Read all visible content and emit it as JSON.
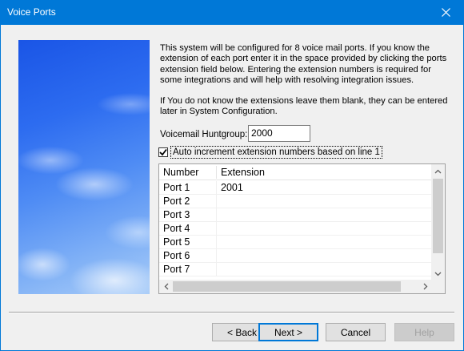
{
  "window": {
    "title": "Voice Ports",
    "close_icon": "close-icon"
  },
  "intro": {
    "paragraph1": "This system will be configured for 8 voice mail ports.  If you know the extension of each port enter it in the space provided by clicking the ports extension field below.  Entering the extension numbers is required for some integrations and will help with resolving integration issues.",
    "paragraph2": "If You do not know the extensions leave them blank, they can be entered later in System Configuration."
  },
  "huntgroup": {
    "label": "Voicemail Huntgroup:",
    "value": "2000"
  },
  "auto_increment": {
    "label": "Auto increment extension numbers based on line 1",
    "checked": true
  },
  "grid": {
    "columns": [
      "Number",
      "Extension"
    ],
    "rows": [
      {
        "number": "Port 1",
        "extension": "2001"
      },
      {
        "number": "Port 2",
        "extension": ""
      },
      {
        "number": "Port 3",
        "extension": ""
      },
      {
        "number": "Port 4",
        "extension": ""
      },
      {
        "number": "Port 5",
        "extension": ""
      },
      {
        "number": "Port 6",
        "extension": ""
      },
      {
        "number": "Port 7",
        "extension": ""
      }
    ]
  },
  "buttons": {
    "back": "< Back",
    "next": "Next >",
    "cancel": "Cancel",
    "help": "Help"
  },
  "colors": {
    "titlebar": "#0078d7",
    "accent": "#0078d7"
  }
}
